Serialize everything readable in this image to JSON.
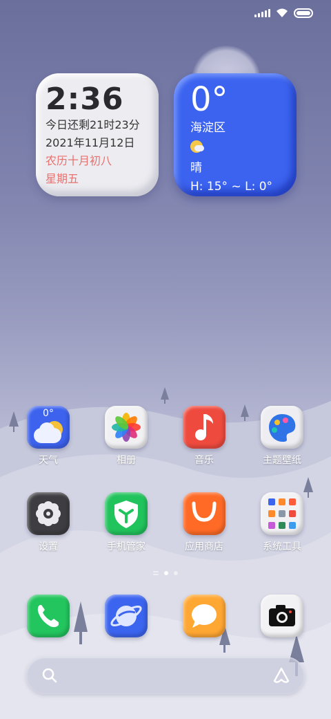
{
  "status_bar": {
    "icons": [
      "signal-icon",
      "wifi-icon",
      "battery-icon"
    ],
    "battery_level": 1.0
  },
  "clock_widget": {
    "time": "2:36",
    "countdown": "今日还剩21时23分",
    "date": "2021年11月12日",
    "lunar": "农历十月初八",
    "weekday": "星期五"
  },
  "weather_widget": {
    "temp": "0°",
    "location": "海淀区",
    "icon": "partly-cloudy-icon",
    "condition": "晴",
    "range": "H: 15° ~ L: 0°"
  },
  "apps": [
    {
      "label": "天气",
      "icon": "weather-icon",
      "icon_text": "0°",
      "color": "#3c62ee"
    },
    {
      "label": "相册",
      "icon": "gallery-icon",
      "color": "#f1f1f3"
    },
    {
      "label": "音乐",
      "icon": "music-icon",
      "color": "#ef4a3e"
    },
    {
      "label": "主题壁纸",
      "icon": "theme-icon",
      "color": "#eeeef2"
    },
    {
      "label": "设置",
      "icon": "settings-icon",
      "color": "#3e3e42"
    },
    {
      "label": "手机管家",
      "icon": "security-icon",
      "color": "#21c35c"
    },
    {
      "label": "应用商店",
      "icon": "app-store-icon",
      "color": "#ff6a26"
    },
    {
      "label": "系统工具",
      "icon": "tools-folder-icon",
      "color": "#f2f2f5"
    }
  ],
  "page_indicator": {
    "pages": 2,
    "active": 1
  },
  "dock": [
    {
      "name": "phone",
      "icon": "phone-icon",
      "color": "#22c55e"
    },
    {
      "name": "browser",
      "icon": "browser-icon",
      "color": "#3b64ef"
    },
    {
      "name": "messages",
      "icon": "message-icon",
      "color": "#ffa733"
    },
    {
      "name": "camera",
      "icon": "camera-icon",
      "color": "#f2f2f4"
    }
  ],
  "search_bar": {
    "search_icon": "search-icon",
    "assistant_icon": "assistant-icon"
  }
}
